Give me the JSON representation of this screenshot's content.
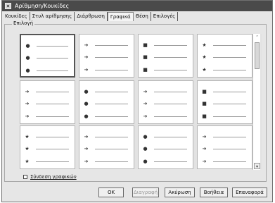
{
  "window": {
    "title": "Αρίθμηση/Κουκίδες"
  },
  "tabs": [
    {
      "label": "Κουκίδες"
    },
    {
      "label": "Στυλ αρίθμησης"
    },
    {
      "label": "Διάρθρωση"
    },
    {
      "label": "Γραφικά"
    },
    {
      "label": "Θέση"
    },
    {
      "label": "Επιλογές"
    }
  ],
  "active_tab": "Γραφικά",
  "group": {
    "label": "Επιλογή"
  },
  "grid": {
    "selected_index": 0,
    "rows": [
      [
        "sphere",
        "arrow",
        "cube",
        "star"
      ],
      [
        "arrow",
        "sphere",
        "arrow",
        "cube"
      ],
      [
        "star",
        "arrow",
        "sphere",
        "arrow"
      ]
    ],
    "icon_glyphs": {
      "sphere": "●",
      "arrow": "➔",
      "cube": "■",
      "star": "★"
    }
  },
  "link_graphics": {
    "label": "Σύνδεση γραφικών",
    "checked": false
  },
  "buttons": {
    "ok": "OK",
    "delete": "Διαγραφή",
    "cancel": "Ακύρωση",
    "help": "Βοήθεια",
    "reset": "Επαναφορά"
  }
}
